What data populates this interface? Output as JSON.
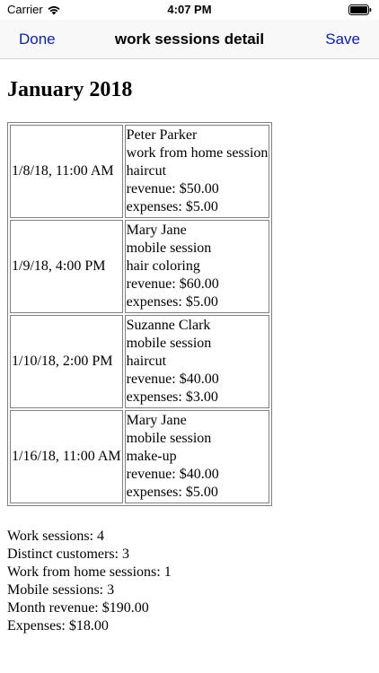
{
  "status_bar": {
    "carrier": "Carrier",
    "time": "4:07 PM",
    "wifi_icon": "wifi-icon",
    "battery_icon": "battery-icon"
  },
  "nav": {
    "left_label": "Done",
    "title": "work sessions detail",
    "right_label": "Save",
    "tint_color": "#0a1fb4"
  },
  "month_title": "January 2018",
  "sessions": [
    {
      "date": "1/8/18, 11:00 AM",
      "customer": "Peter Parker",
      "session_type": "work from home session",
      "service": "haircut",
      "revenue": "revenue: $50.00",
      "expenses": "expenses: $5.00"
    },
    {
      "date": "1/9/18, 4:00 PM",
      "customer": "Mary Jane",
      "session_type": "mobile session",
      "service": "hair coloring",
      "revenue": "revenue: $60.00",
      "expenses": "expenses: $5.00"
    },
    {
      "date": "1/10/18, 2:00 PM",
      "customer": "Suzanne Clark",
      "session_type": "mobile session",
      "service": "haircut",
      "revenue": "revenue: $40.00",
      "expenses": "expenses: $3.00"
    },
    {
      "date": "1/16/18, 11:00 AM",
      "customer": "Mary Jane",
      "session_type": "mobile session",
      "service": "make-up",
      "revenue": "revenue: $40.00",
      "expenses": "expenses: $5.00"
    }
  ],
  "summary": {
    "work_sessions": "Work sessions: 4",
    "distinct_customers": "Distinct customers: 3",
    "work_from_home_sessions": "Work from home sessions: 1",
    "mobile_sessions": "Mobile sessions: 3",
    "month_revenue": "Month revenue: $190.00",
    "expenses": "Expenses: $18.00"
  }
}
